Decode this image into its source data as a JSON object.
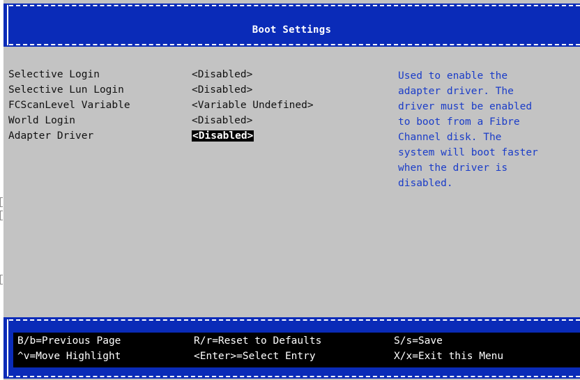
{
  "header": {
    "title": "Boot Settings"
  },
  "settings": [
    {
      "label": "Selective Login",
      "value": "<Disabled>"
    },
    {
      "label": "Selective Lun Login",
      "value": "<Disabled>"
    },
    {
      "label": "FCScanLevel Variable",
      "value": "<Variable Undefined>"
    },
    {
      "label": "World Login",
      "value": "<Disabled>"
    },
    {
      "label": "Adapter Driver",
      "value": "<Disabled>",
      "selected": true
    }
  ],
  "help": {
    "lines": [
      "Used to enable the",
      "adapter driver. The",
      "driver must be enabled",
      "to boot from a Fibre",
      "Channel disk. The",
      "system will boot faster",
      "when the driver is",
      "disabled."
    ]
  },
  "footer": {
    "keys": [
      "B/b=Previous Page",
      "R/r=Reset to Defaults",
      "S/s=Save",
      "^v=Move Highlight",
      "<Enter>=Select Entry",
      "X/x=Exit this Menu"
    ]
  },
  "colors": {
    "frame_blue": "#0a2bb8",
    "background_gray": "#c3c3c3",
    "help_text_blue": "#1a3cc8",
    "footer_black": "#000000"
  }
}
